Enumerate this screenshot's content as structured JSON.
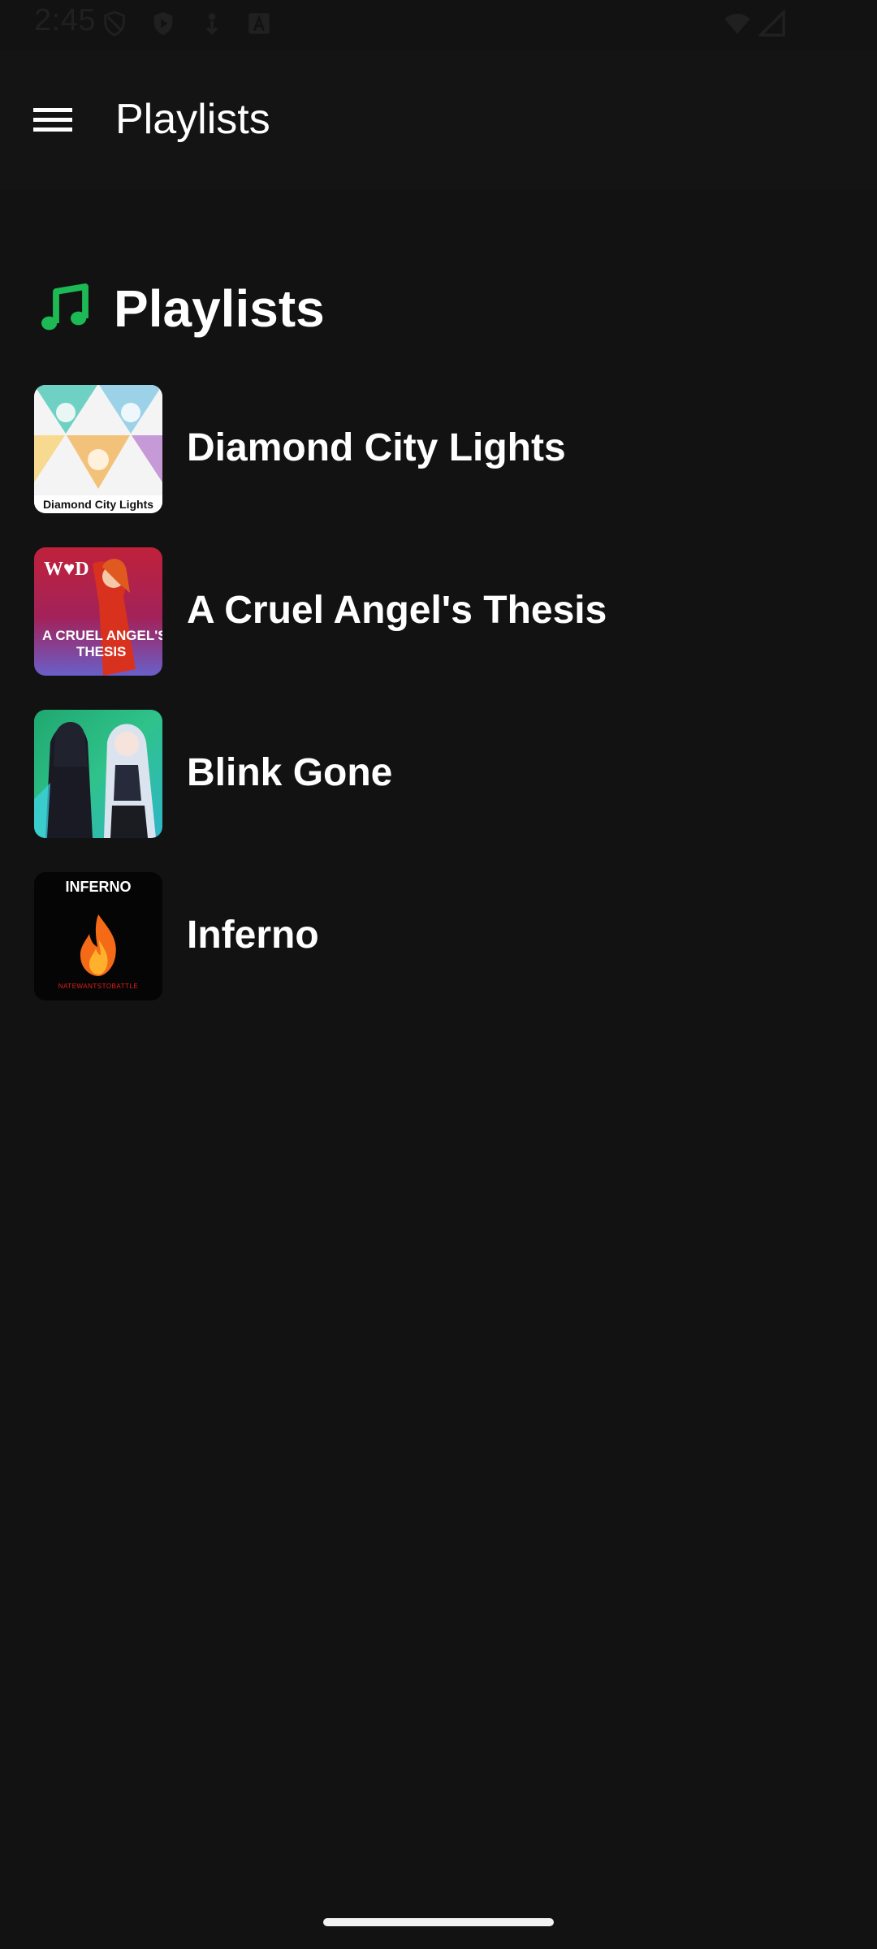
{
  "status_bar": {
    "time": "2:45",
    "icons": [
      "shield-icon",
      "play-protect-icon",
      "download-icon",
      "notification-a-icon",
      "wifi-icon",
      "signal-icon"
    ]
  },
  "app_bar": {
    "title": "Playlists",
    "menu_icon": "hamburger-menu-icon"
  },
  "section": {
    "title": "Playlists",
    "icon": "music-note-icon",
    "accent_color": "#1DB954"
  },
  "playlists": [
    {
      "name": "Diamond City Lights",
      "cover_text": "Diamond City Lights"
    },
    {
      "name": "A Cruel Angel's Thesis",
      "cover_text": "A CRUEL ANGEL'S THESIS"
    },
    {
      "name": "Blink Gone"
    },
    {
      "name": "Inferno",
      "cover_text": "INFERNO",
      "cover_subtext": "NATEWANTSTOBATTLE"
    }
  ],
  "colors": {
    "background": "#121212",
    "app_bar": "#141414",
    "text": "#FFFFFF"
  }
}
